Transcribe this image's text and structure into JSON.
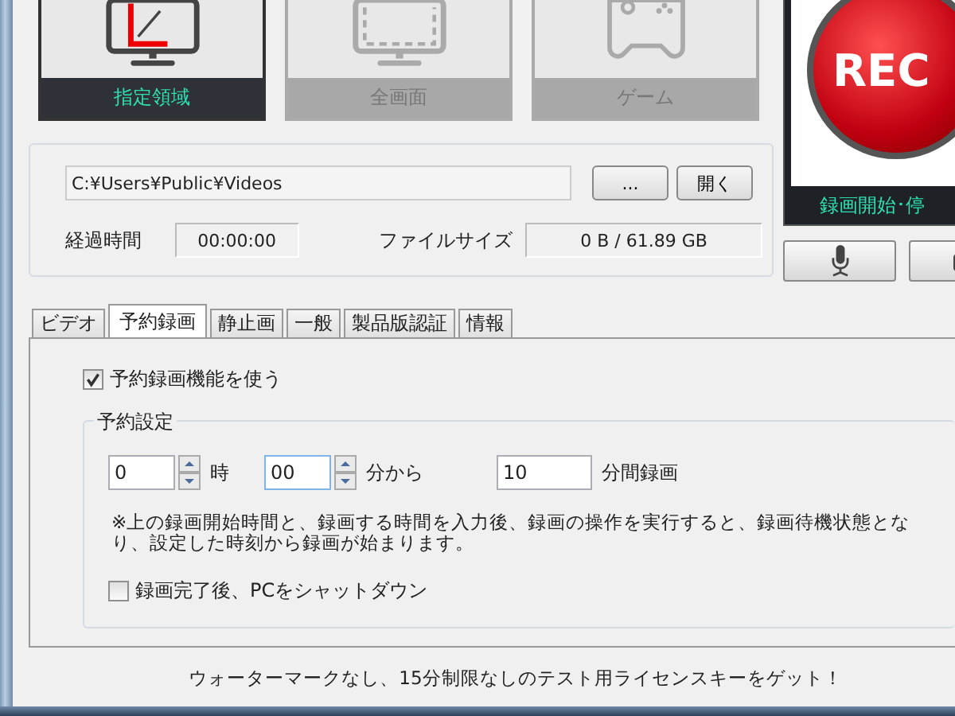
{
  "capture_modes": [
    {
      "kind": "region",
      "label": "指定領域",
      "selected": true
    },
    {
      "kind": "fullscreen",
      "label": "全画面",
      "selected": false
    },
    {
      "kind": "game",
      "label": "ゲーム",
      "selected": false
    }
  ],
  "rec_button": {
    "label": "REC",
    "caption": "録画開始･停"
  },
  "output": {
    "path": "C:¥Users¥Public¥Videos",
    "browse_button": "...",
    "open_button": "開く",
    "elapsed_label": "経過時間",
    "elapsed": "00:00:00",
    "size_label": "ファイルサイズ",
    "size": "0 B / 61.89 GB"
  },
  "tabs": [
    {
      "label": "ビデオ",
      "selected": false
    },
    {
      "label": "予約録画",
      "selected": true
    },
    {
      "label": "静止画",
      "selected": false
    },
    {
      "label": "一般",
      "selected": false
    },
    {
      "label": "製品版認証",
      "selected": false
    },
    {
      "label": "情報",
      "selected": false
    }
  ],
  "schedule": {
    "enable": {
      "label": "予約録画機能を使う",
      "checked": true
    },
    "group_title": "予約設定",
    "hour": "0",
    "hour_unit": "時",
    "minute": "00",
    "minute_unit": "分から",
    "duration": "10",
    "duration_unit": "分間録画",
    "note": "※上の録画開始時間と、録画する時間を入力後、録画の操作を実行すると、録画待機状態となり、設定した時刻から録画が始まります。",
    "shutdown": {
      "label": "録画完了後、PCをシャットダウン",
      "checked": false
    }
  },
  "footer": "ウォーターマークなし、15分制限なしのテスト用ライセンスキーをゲット！"
}
